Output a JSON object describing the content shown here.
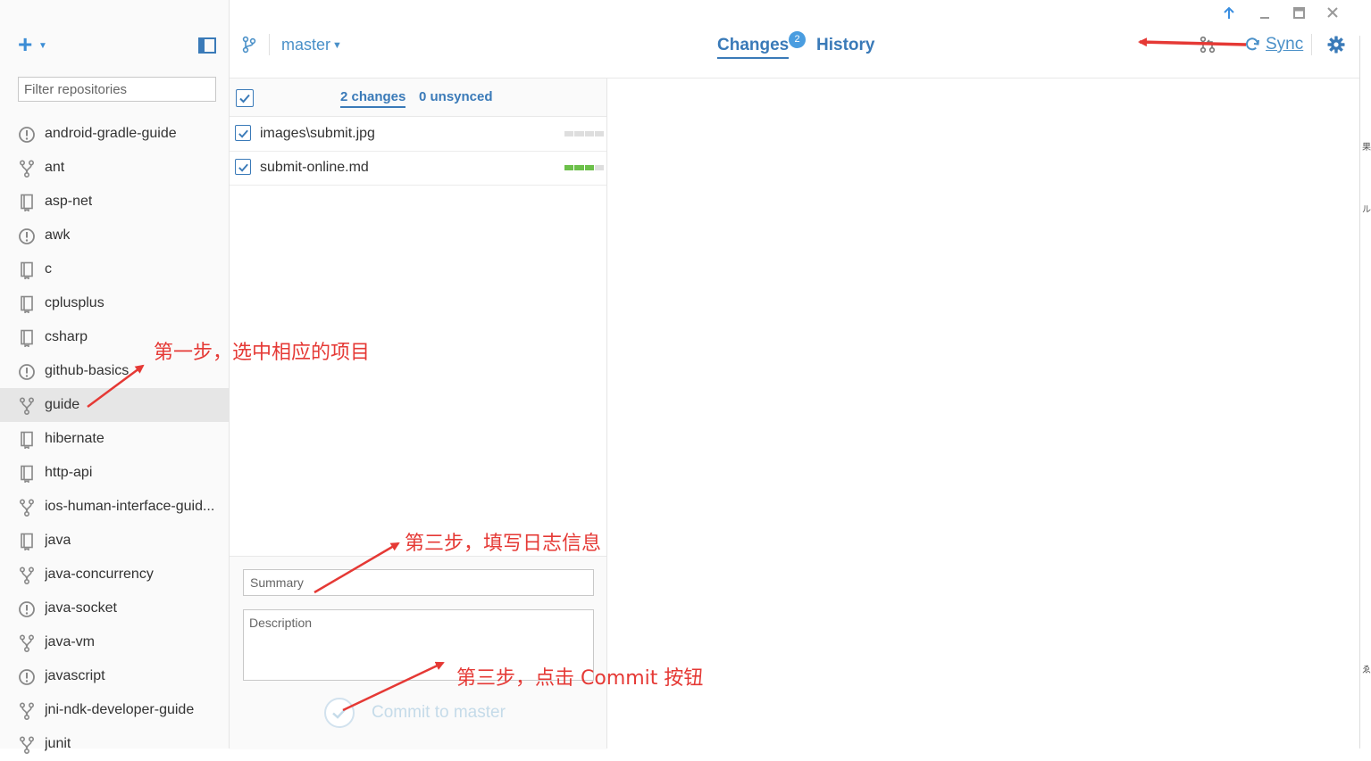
{
  "sidebar": {
    "filter_placeholder": "Filter repositories",
    "repositories": [
      {
        "label": "android-gradle-guide",
        "icon": "alert-icon"
      },
      {
        "label": "ant",
        "icon": "fork-icon"
      },
      {
        "label": "asp-net",
        "icon": "repo-book-icon"
      },
      {
        "label": "awk",
        "icon": "alert-icon"
      },
      {
        "label": "c",
        "icon": "repo-book-icon"
      },
      {
        "label": "cplusplus",
        "icon": "repo-book-icon"
      },
      {
        "label": "csharp",
        "icon": "repo-book-icon"
      },
      {
        "label": "github-basics",
        "icon": "alert-icon"
      },
      {
        "label": "guide",
        "icon": "fork-icon",
        "selected": true
      },
      {
        "label": "hibernate",
        "icon": "repo-book-icon"
      },
      {
        "label": "http-api",
        "icon": "repo-book-icon"
      },
      {
        "label": "ios-human-interface-guid...",
        "icon": "fork-icon"
      },
      {
        "label": "java",
        "icon": "repo-book-icon"
      },
      {
        "label": "java-concurrency",
        "icon": "fork-icon"
      },
      {
        "label": "java-socket",
        "icon": "alert-icon"
      },
      {
        "label": "java-vm",
        "icon": "fork-icon"
      },
      {
        "label": "javascript",
        "icon": "alert-icon"
      },
      {
        "label": "jni-ndk-developer-guide",
        "icon": "fork-icon"
      },
      {
        "label": "junit",
        "icon": "fork-icon"
      }
    ]
  },
  "topbar": {
    "branch": "master",
    "tabs": {
      "changes": "Changes",
      "history": "History"
    },
    "changes_badge": "2",
    "sync_label": "Sync"
  },
  "changes": {
    "count_label": "2 changes",
    "unsynced_label": "0 unsynced",
    "files": [
      {
        "name": "images\\submit.jpg",
        "diff": [
          0,
          0,
          0,
          0
        ]
      },
      {
        "name": "submit-online.md",
        "diff": [
          1,
          1,
          1,
          0
        ]
      }
    ]
  },
  "commit": {
    "summary_placeholder": "Summary",
    "description_placeholder": "Description",
    "button_label": "Commit to master"
  },
  "right_strip_chars": [
    "果",
    "ル",
    "ゑ"
  ],
  "annotations": {
    "step1": "第一步，选中相应的项目",
    "step2": "第三步，填写日志信息",
    "step3": "第三步，点击 Commit 按钮"
  },
  "colors": {
    "accent": "#3a7ab8",
    "annotation": "#e53935",
    "diff_added": "#6cc04a",
    "badge": "#4a9de0"
  }
}
